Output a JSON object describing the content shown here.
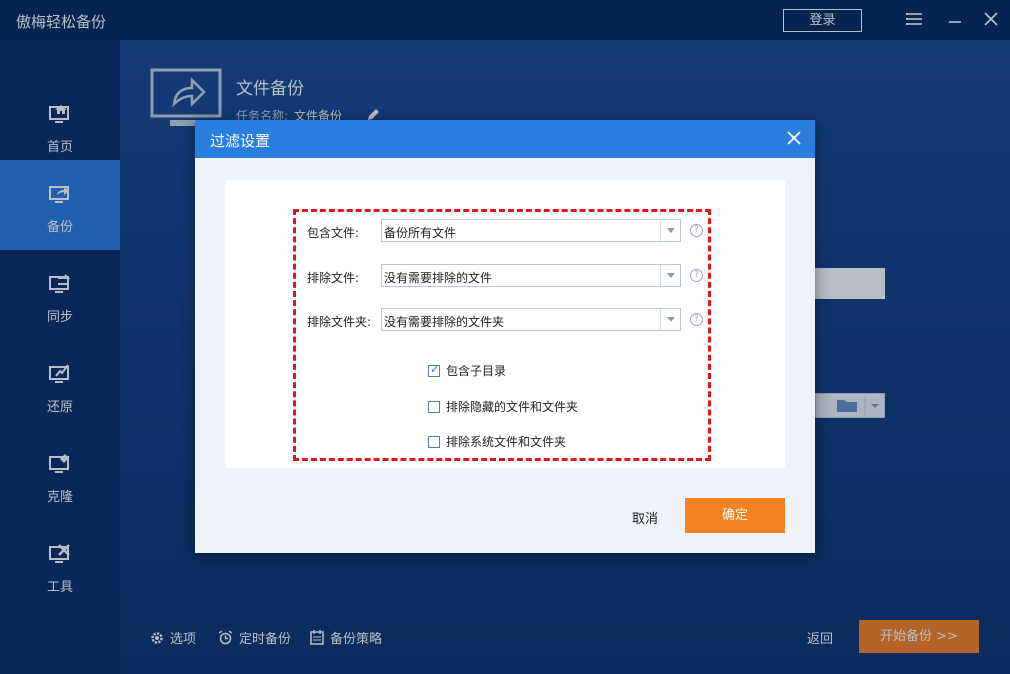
{
  "app": {
    "title": "傲梅轻松备份",
    "login_label": "登录"
  },
  "sidebar": {
    "items": [
      {
        "label": "首页",
        "icon": "home-monitor-icon"
      },
      {
        "label": "备份",
        "icon": "backup-monitor-icon",
        "active": true
      },
      {
        "label": "同步",
        "icon": "sync-monitor-icon"
      },
      {
        "label": "还原",
        "icon": "restore-monitor-icon"
      },
      {
        "label": "克隆",
        "icon": "clone-monitor-icon"
      },
      {
        "label": "工具",
        "icon": "tools-monitor-icon"
      }
    ]
  },
  "main": {
    "title": "文件备份",
    "task_label": "任务名称:",
    "task_value": "文件备份"
  },
  "bottom": {
    "options_label": "选项",
    "schedule_label": "定时备份",
    "strategy_label": "备份策略",
    "back_label": "返回",
    "start_label": "开始备份 >>"
  },
  "dialog": {
    "title": "过滤设置",
    "include_files_label": "包含文件:",
    "include_files_value": "备份所有文件",
    "exclude_files_label": "排除文件:",
    "exclude_files_value": "没有需要排除的文件",
    "exclude_folders_label": "排除文件夹:",
    "exclude_folders_value": "没有需要排除的文件夹",
    "checkboxes": [
      {
        "label": "包含子目录",
        "checked": true
      },
      {
        "label": "排除隐藏的文件和文件夹",
        "checked": false
      },
      {
        "label": "排除系统文件和文件夹",
        "checked": false
      }
    ],
    "cancel_label": "取消",
    "ok_label": "确定"
  },
  "colors": {
    "accent_blue": "#2a7ee0",
    "orange": "#f58220",
    "highlight_red": "#e0141e"
  }
}
